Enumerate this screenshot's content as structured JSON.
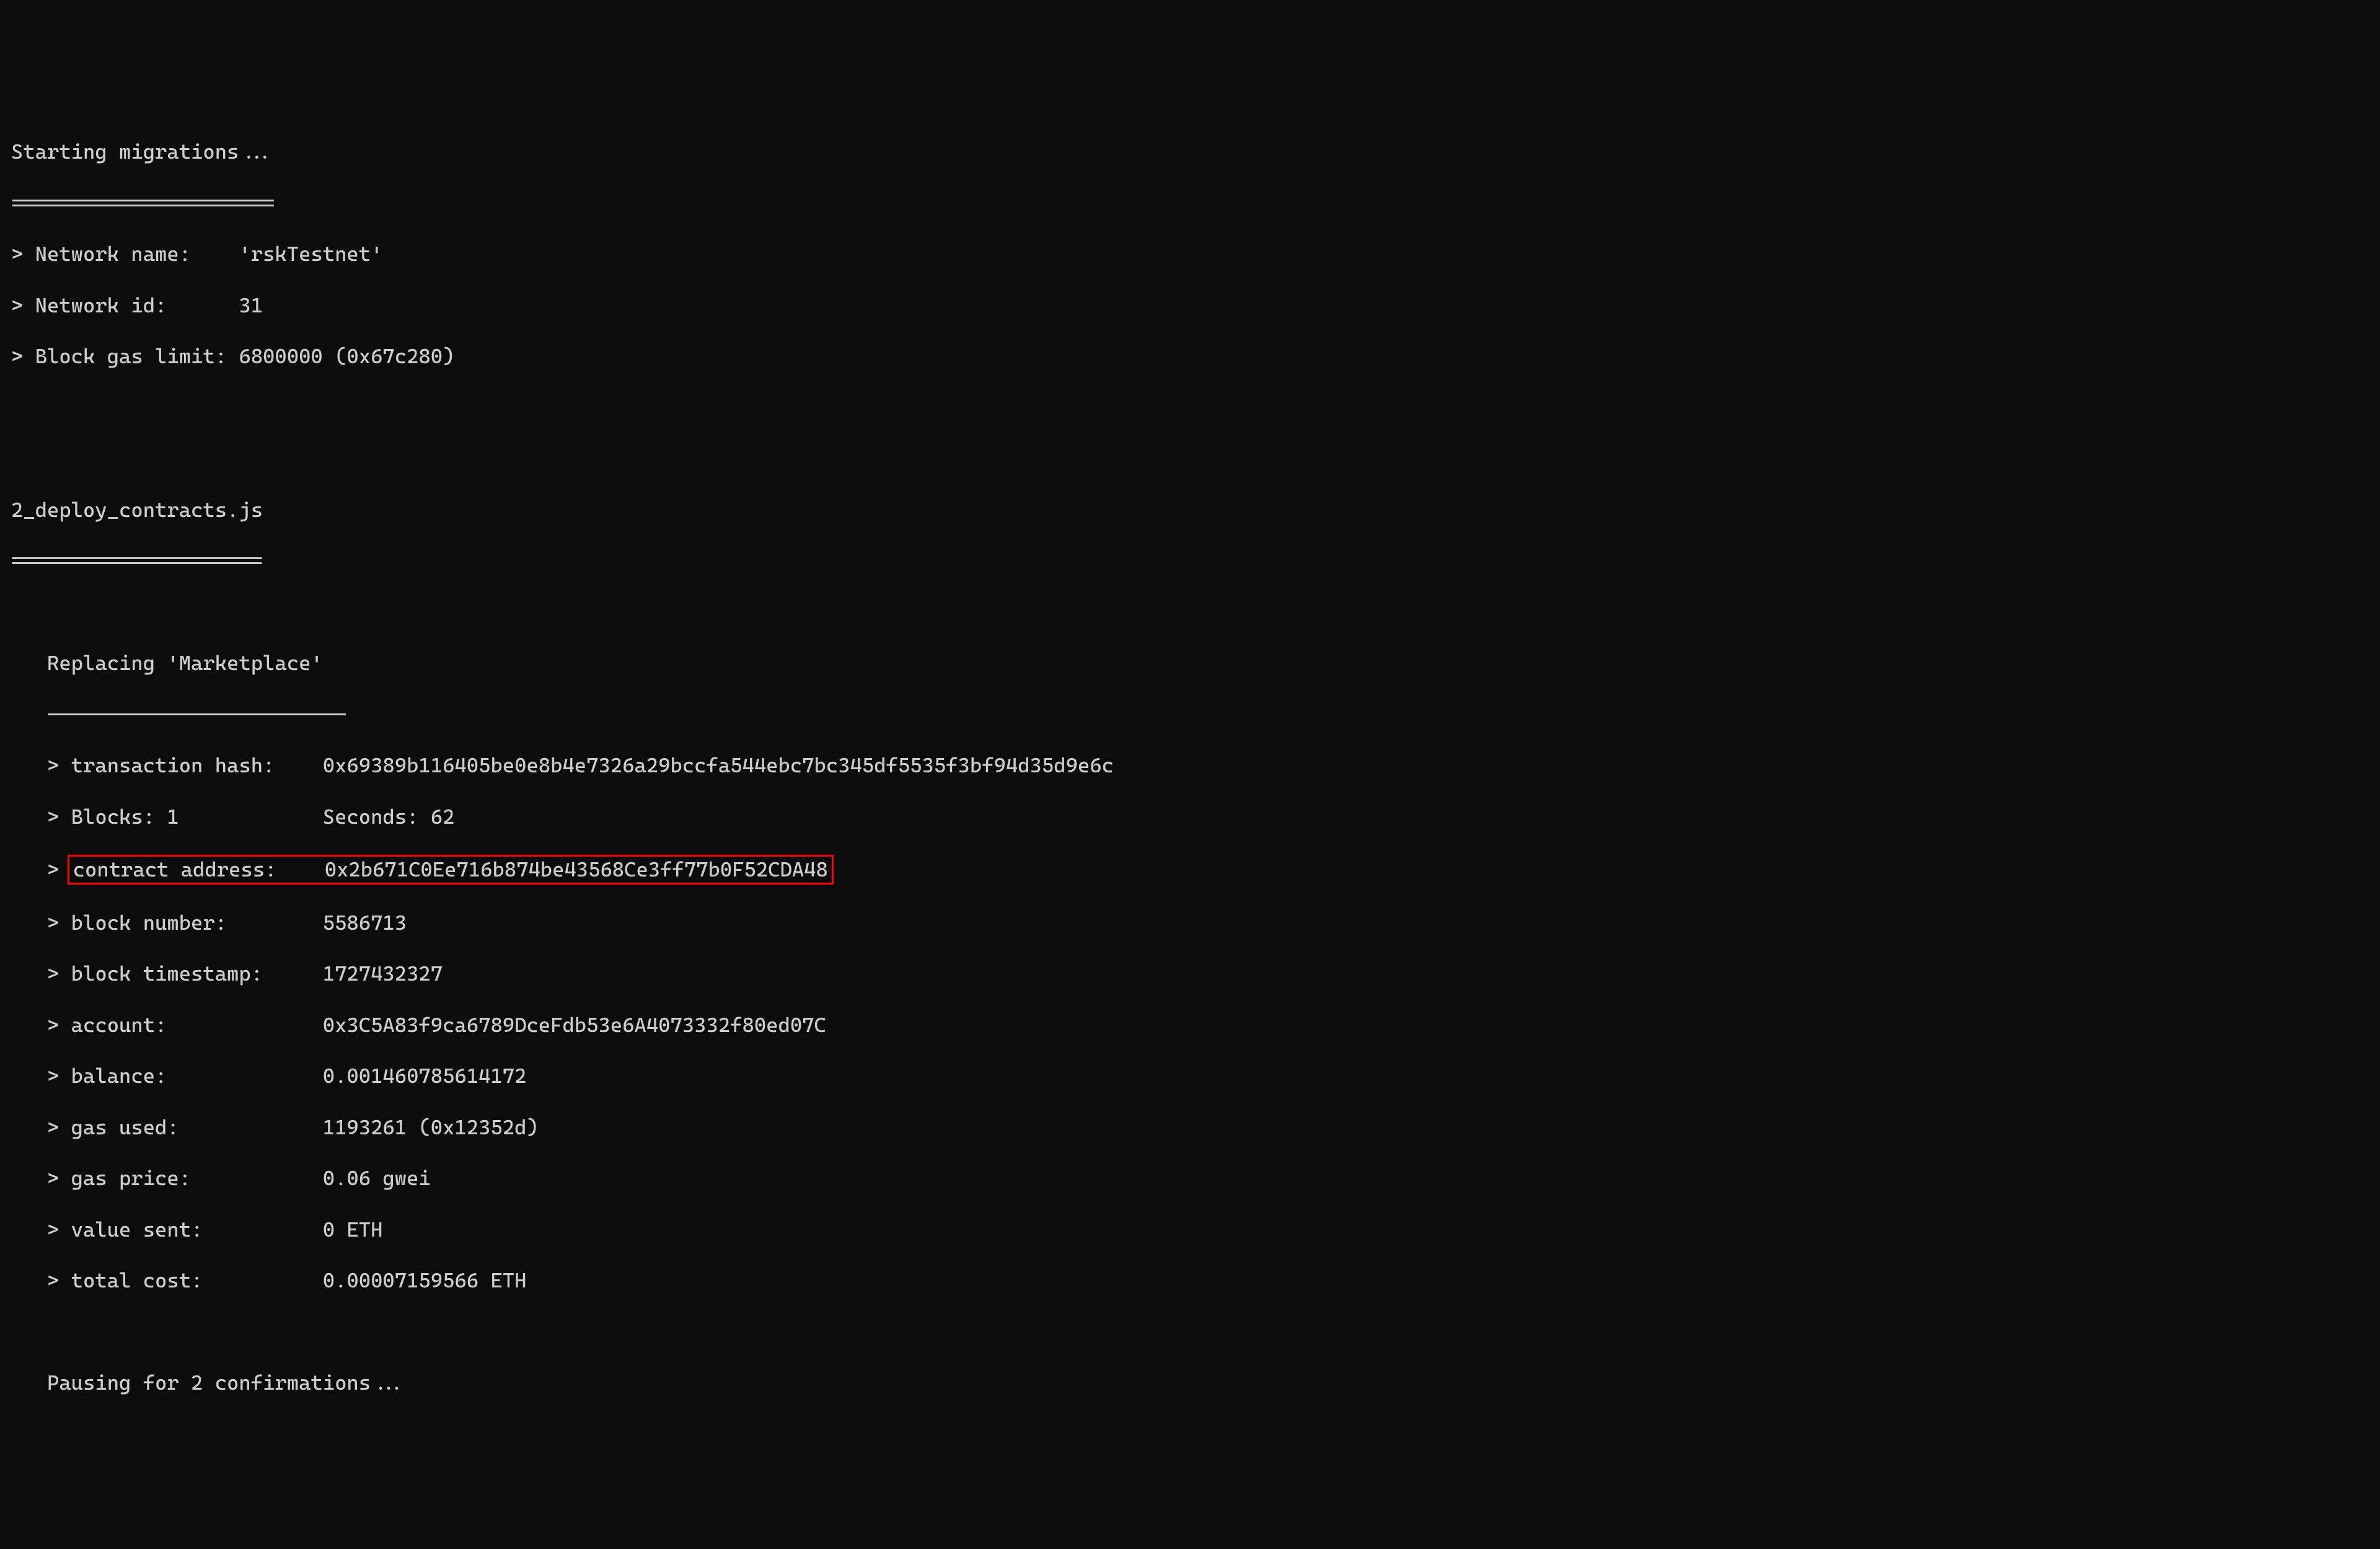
{
  "header": {
    "starting": "Starting migrations...",
    "divider": "======================",
    "network_name_line": "> Network name:    'rskTestnet'",
    "network_id_line": "> Network id:      31",
    "block_gas_limit_line": "> Block gas limit: 6800000 (0x67c280)"
  },
  "migration": {
    "file": "2_deploy_contracts.js",
    "divider": "=====================",
    "replacing": "   Replacing 'Marketplace'",
    "replacing_divider": "   -------------------------"
  },
  "details": {
    "tx_hash_label": "   > transaction hash:    ",
    "tx_hash_value": "0x69389b116405be0e8b4e7326a29bccfa544ebc7bc345df5535f3bf94d35d9e6c",
    "blocks_line": "   > Blocks: 1            Seconds: 62",
    "contract_prefix": "   > ",
    "contract_boxed": "contract address:    0x2b671C0Ee716b874be43568Ce3ff77b0F52CDA48",
    "block_number_line": "   > block number:        5586713",
    "block_timestamp_line": "   > block timestamp:     1727432327",
    "account_line": "   > account:             0x3C5A83f9ca6789DceFdb53e6A4073332f80ed07C",
    "balance_line": "   > balance:             0.001460785614172",
    "gas_used_line": "   > gas used:            1193261 (0x12352d)",
    "gas_price_line": "   > gas price:           0.06 gwei",
    "value_sent_line": "   > value sent:          0 ETH",
    "total_cost_line": "   > total cost:          0.00007159566 ETH"
  },
  "footer": {
    "pausing": "   Pausing for 2 confirmations..."
  }
}
